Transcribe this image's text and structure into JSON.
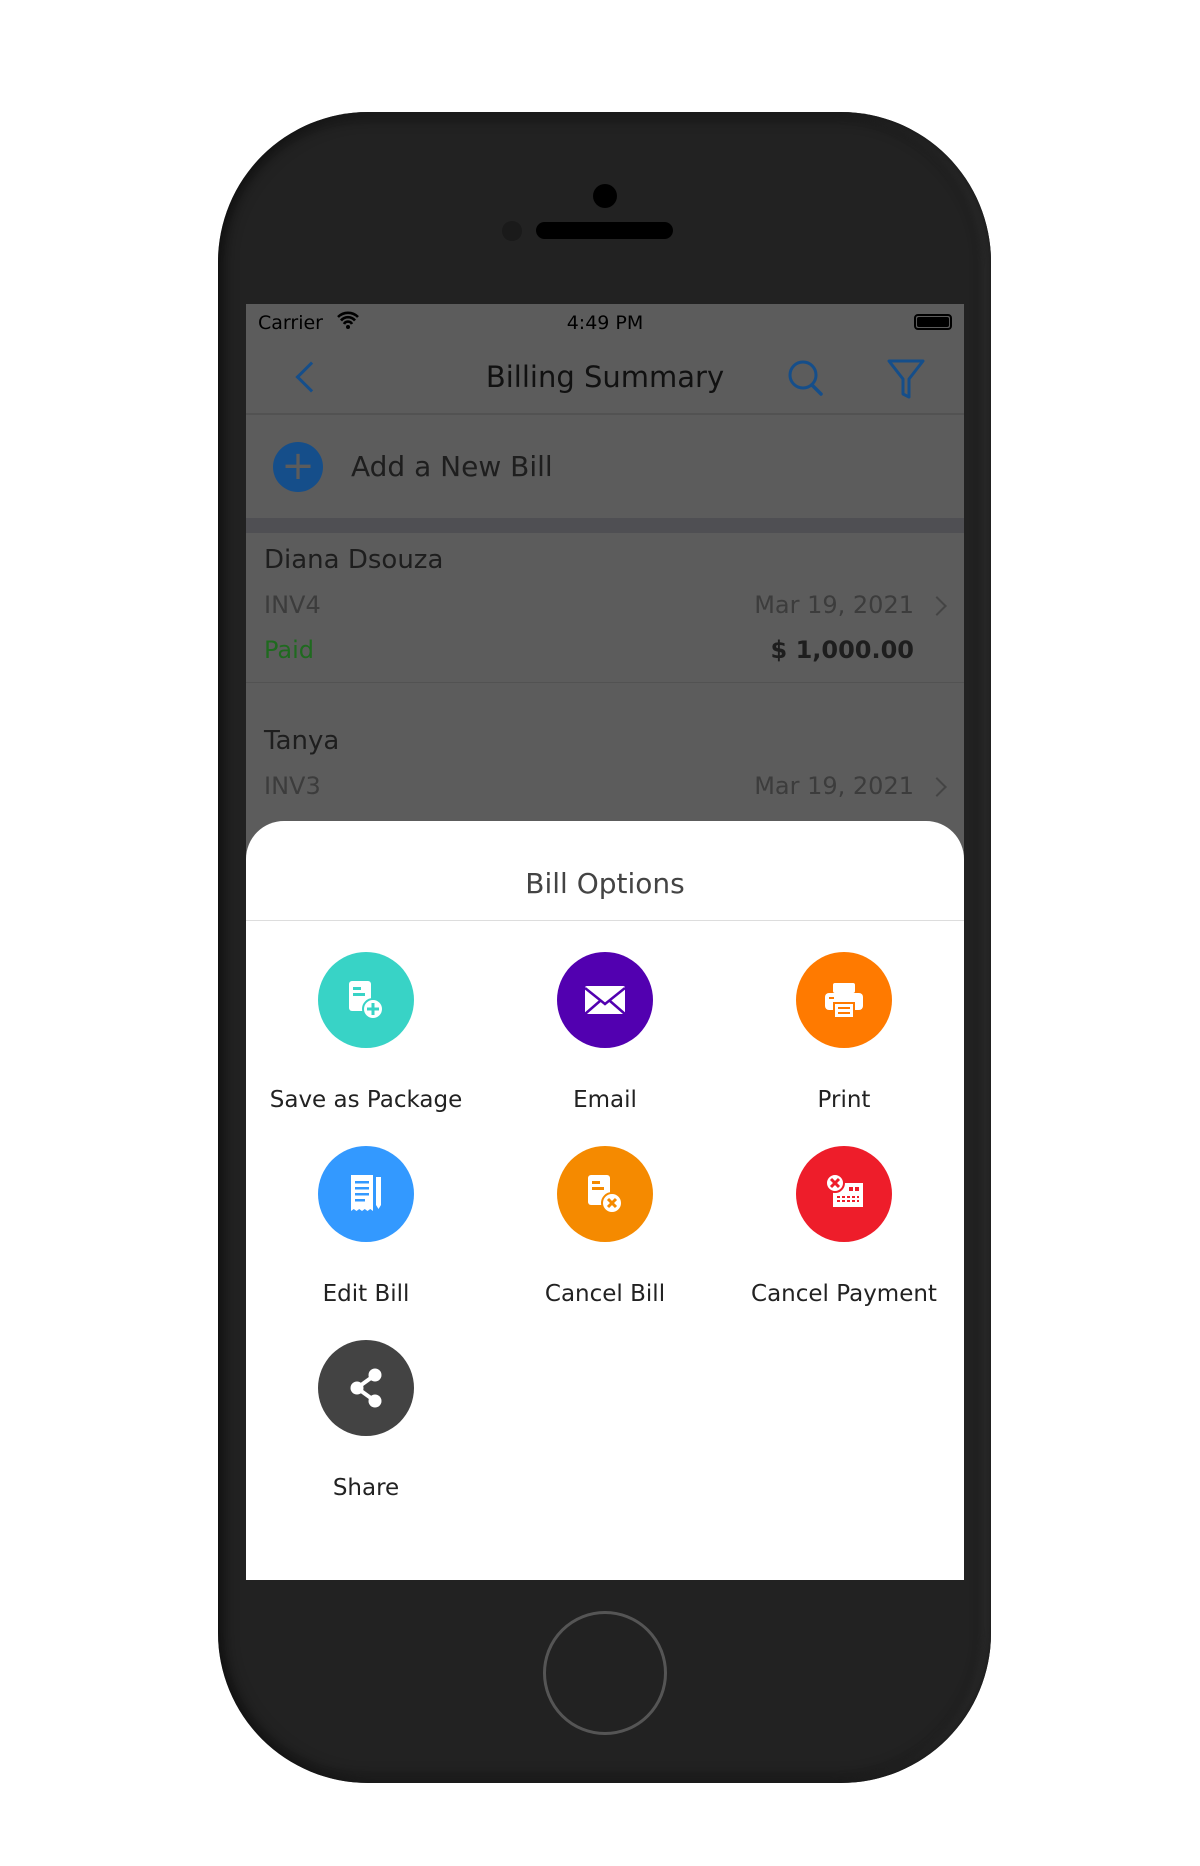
{
  "status_bar": {
    "carrier": "Carrier",
    "time": "4:49 PM"
  },
  "nav": {
    "title": "Billing Summary",
    "back_icon": "chevron-left-icon",
    "search_icon": "search-icon",
    "filter_icon": "filter-icon",
    "accent": "#1e6fc4"
  },
  "add_bill": {
    "label": "Add a New Bill",
    "icon": "plus-circle-icon"
  },
  "bills": [
    {
      "name": "Diana Dsouza",
      "invoice": "INV4",
      "date": "Mar 19, 2021",
      "status": "Paid",
      "amount": "$ 1,000.00"
    },
    {
      "name": "Tanya",
      "invoice": "INV3",
      "date": "Mar 19, 2021"
    }
  ],
  "sheet": {
    "title": "Bill Options",
    "options": [
      {
        "label": "Save as Package",
        "icon": "document-plus-icon",
        "color": "#38d3c6"
      },
      {
        "label": "Email",
        "icon": "envelope-icon",
        "color": "#5200b0"
      },
      {
        "label": "Print",
        "icon": "printer-icon",
        "color": "#ff7a00"
      },
      {
        "label": "Edit Bill",
        "icon": "receipt-edit-icon",
        "color": "#3399ff"
      },
      {
        "label": "Cancel Bill",
        "icon": "document-cancel-icon",
        "color": "#f58a00"
      },
      {
        "label": "Cancel Payment",
        "icon": "payment-cancel-icon",
        "color": "#ee1d2a"
      },
      {
        "label": "Share",
        "icon": "share-icon",
        "color": "#434343"
      }
    ]
  }
}
